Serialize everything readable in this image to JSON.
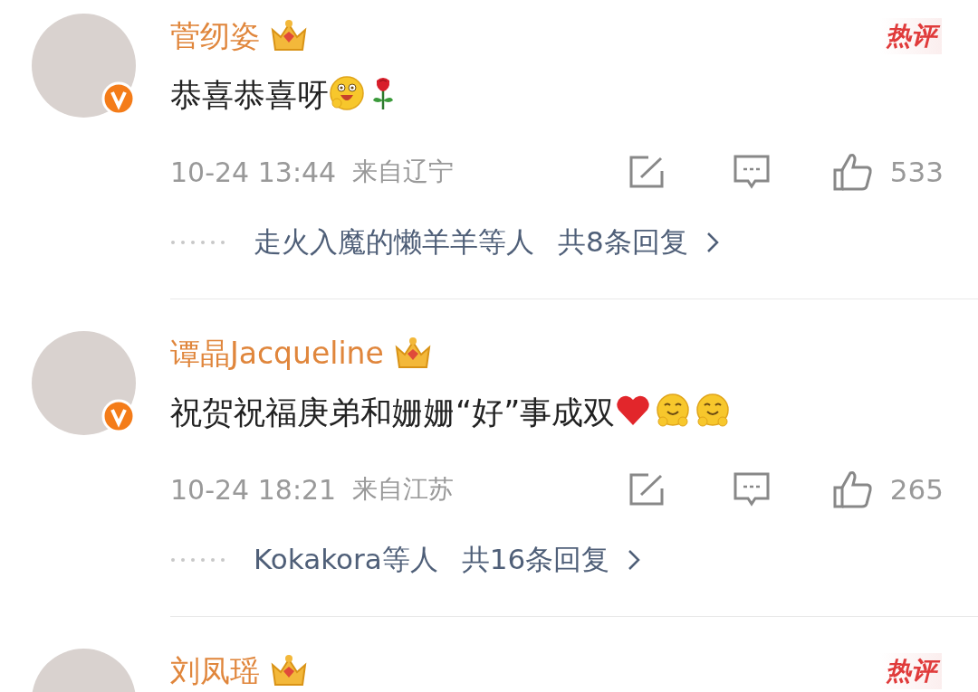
{
  "comments": [
    {
      "name": "菅纫姿",
      "verified": true,
      "hot": true,
      "hot_label": "热评",
      "text": "恭喜恭喜呀",
      "stickers": [
        {
          "kind": "grin"
        },
        {
          "kind": "rose"
        }
      ],
      "time": "10-24 13:44",
      "location": "来自辽宁",
      "likes": "533",
      "replies_by": "走火入魔的懒羊羊等人",
      "replies_count": "共8条回复"
    },
    {
      "name": "谭晶Jacqueline",
      "verified": true,
      "hot": false,
      "text": "祝贺祝福庚弟和姗姗“好”事成双",
      "stickers": [
        {
          "kind": "heart"
        },
        {
          "kind": "hug"
        },
        {
          "kind": "hug"
        }
      ],
      "time": "10-24 18:21",
      "location": "来自江苏",
      "likes": "265",
      "replies_by": "Kokakora等人",
      "replies_count": "共16条回复"
    },
    {
      "name": "刘凤瑶",
      "verified": false,
      "hot": true,
      "hot_label": "热评"
    }
  ]
}
